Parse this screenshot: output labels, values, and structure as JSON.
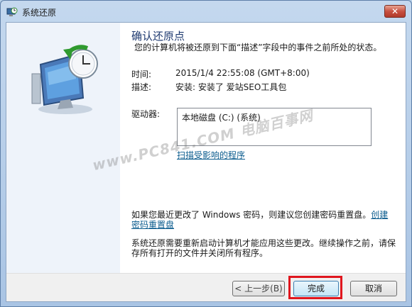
{
  "window": {
    "title": "系统还原",
    "close_label": "✕"
  },
  "content": {
    "heading": "确认还原点",
    "subtitle": "您的计算机将被还原到下面“描述”字段中的事件之前所处的状态。",
    "time_label": "时间:",
    "time_value": "2015/1/4 22:55:08 (GMT+8:00)",
    "desc_label": "描述:",
    "desc_value": "安装: 安装了 爱站SEO工具包",
    "drive_label": "驱动器:",
    "drive_item": "本地磁盘 (C:) (系统)",
    "scan_link": "扫描受影响的程序",
    "note1_text": "如果您最近更改了 Windows 密码，则建议您创建密码重置盘。",
    "note1_link": "创建密码重置盘",
    "note2": "系统还原需要重新启动计算机才能应用这些更改。继续操作之前，请保存所有打开的文件并关闭所有程序。"
  },
  "watermark": "www.PC841.COM 电脑百事网",
  "buttons": {
    "back": "< 上一步(B)",
    "finish": "完成",
    "cancel": "取消"
  },
  "colors": {
    "highlight": "#e0161e",
    "heading": "#1e3a70",
    "link": "#0b5c8e"
  }
}
